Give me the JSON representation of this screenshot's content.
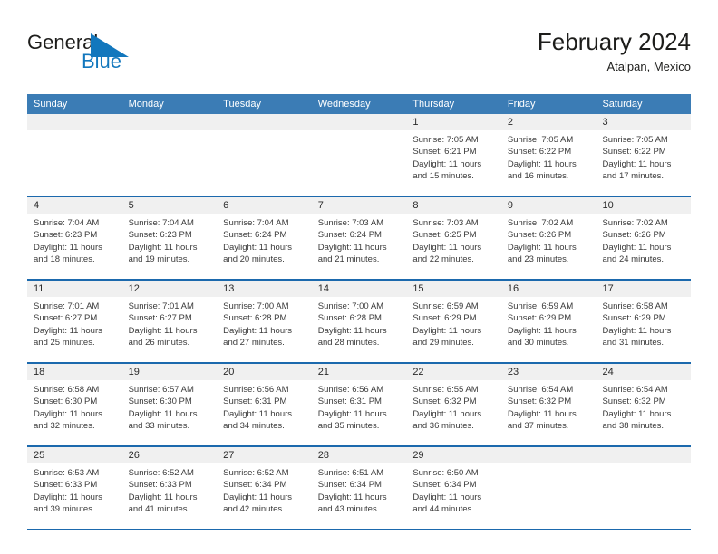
{
  "brand": {
    "name_part1": "General",
    "name_part2": "Blue",
    "triangle_icon": "triangle-icon",
    "color_black": "#1d1d1b",
    "color_blue": "#1277bd"
  },
  "header": {
    "title": "February 2024",
    "subtitle": "Atalpan, Mexico"
  },
  "theme": {
    "header_bar": "#3b7cb5",
    "row_divider": "#1b69ad",
    "daynum_bg": "#f0f0f0",
    "text": "#3a3a3a"
  },
  "weekdays": [
    "Sunday",
    "Monday",
    "Tuesday",
    "Wednesday",
    "Thursday",
    "Friday",
    "Saturday"
  ],
  "weeks": [
    [
      {
        "day": "",
        "lines": []
      },
      {
        "day": "",
        "lines": []
      },
      {
        "day": "",
        "lines": []
      },
      {
        "day": "",
        "lines": []
      },
      {
        "day": "1",
        "lines": [
          "Sunrise: 7:05 AM",
          "Sunset: 6:21 PM",
          "Daylight: 11 hours",
          "and 15 minutes."
        ]
      },
      {
        "day": "2",
        "lines": [
          "Sunrise: 7:05 AM",
          "Sunset: 6:22 PM",
          "Daylight: 11 hours",
          "and 16 minutes."
        ]
      },
      {
        "day": "3",
        "lines": [
          "Sunrise: 7:05 AM",
          "Sunset: 6:22 PM",
          "Daylight: 11 hours",
          "and 17 minutes."
        ]
      }
    ],
    [
      {
        "day": "4",
        "lines": [
          "Sunrise: 7:04 AM",
          "Sunset: 6:23 PM",
          "Daylight: 11 hours",
          "and 18 minutes."
        ]
      },
      {
        "day": "5",
        "lines": [
          "Sunrise: 7:04 AM",
          "Sunset: 6:23 PM",
          "Daylight: 11 hours",
          "and 19 minutes."
        ]
      },
      {
        "day": "6",
        "lines": [
          "Sunrise: 7:04 AM",
          "Sunset: 6:24 PM",
          "Daylight: 11 hours",
          "and 20 minutes."
        ]
      },
      {
        "day": "7",
        "lines": [
          "Sunrise: 7:03 AM",
          "Sunset: 6:24 PM",
          "Daylight: 11 hours",
          "and 21 minutes."
        ]
      },
      {
        "day": "8",
        "lines": [
          "Sunrise: 7:03 AM",
          "Sunset: 6:25 PM",
          "Daylight: 11 hours",
          "and 22 minutes."
        ]
      },
      {
        "day": "9",
        "lines": [
          "Sunrise: 7:02 AM",
          "Sunset: 6:26 PM",
          "Daylight: 11 hours",
          "and 23 minutes."
        ]
      },
      {
        "day": "10",
        "lines": [
          "Sunrise: 7:02 AM",
          "Sunset: 6:26 PM",
          "Daylight: 11 hours",
          "and 24 minutes."
        ]
      }
    ],
    [
      {
        "day": "11",
        "lines": [
          "Sunrise: 7:01 AM",
          "Sunset: 6:27 PM",
          "Daylight: 11 hours",
          "and 25 minutes."
        ]
      },
      {
        "day": "12",
        "lines": [
          "Sunrise: 7:01 AM",
          "Sunset: 6:27 PM",
          "Daylight: 11 hours",
          "and 26 minutes."
        ]
      },
      {
        "day": "13",
        "lines": [
          "Sunrise: 7:00 AM",
          "Sunset: 6:28 PM",
          "Daylight: 11 hours",
          "and 27 minutes."
        ]
      },
      {
        "day": "14",
        "lines": [
          "Sunrise: 7:00 AM",
          "Sunset: 6:28 PM",
          "Daylight: 11 hours",
          "and 28 minutes."
        ]
      },
      {
        "day": "15",
        "lines": [
          "Sunrise: 6:59 AM",
          "Sunset: 6:29 PM",
          "Daylight: 11 hours",
          "and 29 minutes."
        ]
      },
      {
        "day": "16",
        "lines": [
          "Sunrise: 6:59 AM",
          "Sunset: 6:29 PM",
          "Daylight: 11 hours",
          "and 30 minutes."
        ]
      },
      {
        "day": "17",
        "lines": [
          "Sunrise: 6:58 AM",
          "Sunset: 6:29 PM",
          "Daylight: 11 hours",
          "and 31 minutes."
        ]
      }
    ],
    [
      {
        "day": "18",
        "lines": [
          "Sunrise: 6:58 AM",
          "Sunset: 6:30 PM",
          "Daylight: 11 hours",
          "and 32 minutes."
        ]
      },
      {
        "day": "19",
        "lines": [
          "Sunrise: 6:57 AM",
          "Sunset: 6:30 PM",
          "Daylight: 11 hours",
          "and 33 minutes."
        ]
      },
      {
        "day": "20",
        "lines": [
          "Sunrise: 6:56 AM",
          "Sunset: 6:31 PM",
          "Daylight: 11 hours",
          "and 34 minutes."
        ]
      },
      {
        "day": "21",
        "lines": [
          "Sunrise: 6:56 AM",
          "Sunset: 6:31 PM",
          "Daylight: 11 hours",
          "and 35 minutes."
        ]
      },
      {
        "day": "22",
        "lines": [
          "Sunrise: 6:55 AM",
          "Sunset: 6:32 PM",
          "Daylight: 11 hours",
          "and 36 minutes."
        ]
      },
      {
        "day": "23",
        "lines": [
          "Sunrise: 6:54 AM",
          "Sunset: 6:32 PM",
          "Daylight: 11 hours",
          "and 37 minutes."
        ]
      },
      {
        "day": "24",
        "lines": [
          "Sunrise: 6:54 AM",
          "Sunset: 6:32 PM",
          "Daylight: 11 hours",
          "and 38 minutes."
        ]
      }
    ],
    [
      {
        "day": "25",
        "lines": [
          "Sunrise: 6:53 AM",
          "Sunset: 6:33 PM",
          "Daylight: 11 hours",
          "and 39 minutes."
        ]
      },
      {
        "day": "26",
        "lines": [
          "Sunrise: 6:52 AM",
          "Sunset: 6:33 PM",
          "Daylight: 11 hours",
          "and 41 minutes."
        ]
      },
      {
        "day": "27",
        "lines": [
          "Sunrise: 6:52 AM",
          "Sunset: 6:34 PM",
          "Daylight: 11 hours",
          "and 42 minutes."
        ]
      },
      {
        "day": "28",
        "lines": [
          "Sunrise: 6:51 AM",
          "Sunset: 6:34 PM",
          "Daylight: 11 hours",
          "and 43 minutes."
        ]
      },
      {
        "day": "29",
        "lines": [
          "Sunrise: 6:50 AM",
          "Sunset: 6:34 PM",
          "Daylight: 11 hours",
          "and 44 minutes."
        ]
      },
      {
        "day": "",
        "lines": []
      },
      {
        "day": "",
        "lines": []
      }
    ]
  ]
}
